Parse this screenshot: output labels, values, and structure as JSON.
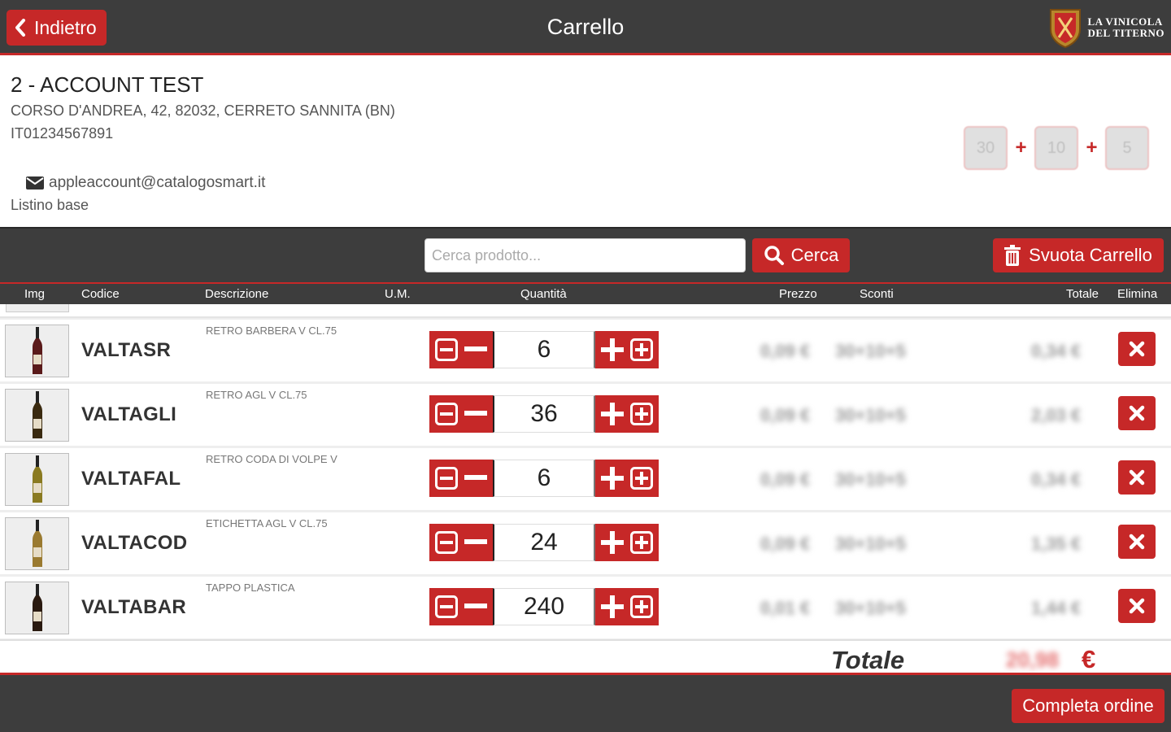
{
  "header": {
    "back_label": "Indietro",
    "title": "Carrello",
    "logo_line1": "LA VINICOLA",
    "logo_line2": "DEL TITERNO",
    "accent_color": "#c62828",
    "bar_color": "#3d3d3d"
  },
  "account": {
    "name": "2 - ACCOUNT TEST",
    "address": "CORSO D'ANDREA, 42, 82032, CERRETO SANNITA (BN)",
    "vat": "IT01234567891",
    "email": "appleaccount@catalogosmart.it",
    "price_list": "Listino base",
    "discounts": [
      "30",
      "10",
      "5"
    ]
  },
  "toolbar": {
    "search_placeholder": "Cerca prodotto...",
    "search_label": "Cerca",
    "clear_cart_label": "Svuota Carrello"
  },
  "columns": {
    "img": "Img",
    "code": "Codice",
    "description": "Descrizione",
    "um": "U.M.",
    "quantity": "Quantità",
    "price": "Prezzo",
    "discounts": "Sconti",
    "total": "Totale",
    "delete": "Elimina"
  },
  "rows": [
    {
      "code": "VALTASR",
      "description": "RETRO BARBERA V CL.75",
      "quantity": "6",
      "price": "0,09 €",
      "discounts": "30+10+5",
      "total": "0,34 €",
      "bottle_color": "#5a1a1a"
    },
    {
      "code": "VALTAGLI",
      "description": "RETRO AGL V CL.75",
      "quantity": "36",
      "price": "0,09 €",
      "discounts": "30+10+5",
      "total": "2,03 €",
      "bottle_color": "#3a2a10"
    },
    {
      "code": "VALTAFAL",
      "description": "RETRO CODA DI VOLPE V",
      "quantity": "6",
      "price": "0,09 €",
      "discounts": "30+10+5",
      "total": "0,34 €",
      "bottle_color": "#8a7a20"
    },
    {
      "code": "VALTACOD",
      "description": "ETICHETTA AGL V CL.75",
      "quantity": "24",
      "price": "0,09 €",
      "discounts": "30+10+5",
      "total": "1,35 €",
      "bottle_color": "#9a7a30"
    },
    {
      "code": "VALTABAR",
      "description": "TAPPO PLASTICA",
      "quantity": "240",
      "price": "0,01 €",
      "discounts": "30+10+5",
      "total": "1,44 €",
      "bottle_color": "#2a1a10"
    }
  ],
  "summary": {
    "total_label": "Totale",
    "total_value": "20,98",
    "currency": "€"
  },
  "footer": {
    "complete_label": "Completa ordine"
  }
}
